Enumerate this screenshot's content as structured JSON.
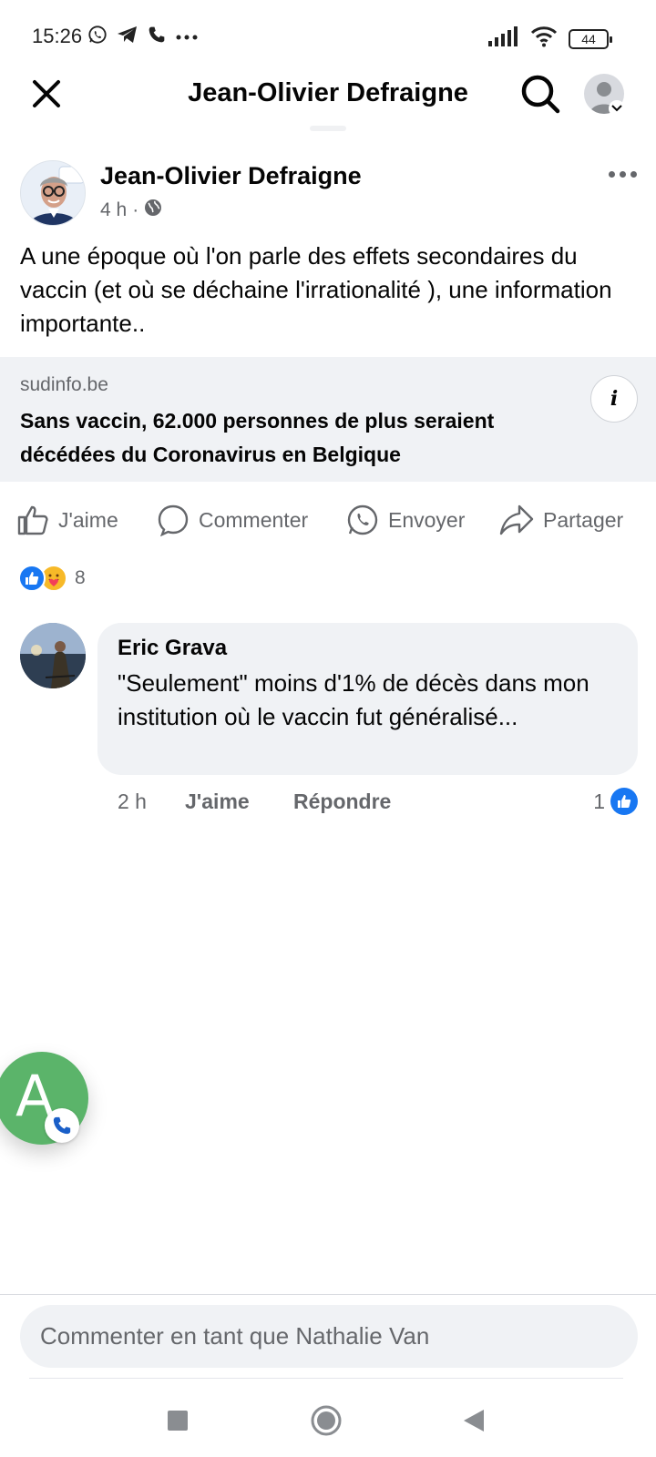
{
  "status_bar": {
    "time": "15:26",
    "battery": "44",
    "icons": [
      "whatsapp-icon",
      "telegram-icon",
      "phone-icon",
      "more-dots-icon",
      "signal-icon",
      "wifi-icon",
      "battery-icon"
    ]
  },
  "top_bar": {
    "title": "Jean-Olivier Defraigne",
    "icons": [
      "close-icon",
      "search-icon",
      "profile-icon"
    ]
  },
  "post": {
    "author": "Jean-Olivier Defraigne",
    "time": "4 h",
    "separator": "·",
    "text": "A une époque où l'on parle des effets secondaires du vaccin (et où se déchaine l'irrationalité ), une information importante..",
    "link": {
      "domain": "sudinfo.be",
      "title": "Sans vaccin, 62.000 personnes de plus seraient décédées du Coronavirus en Belgique",
      "info_label": "i"
    },
    "actions": {
      "like": "J'aime",
      "comment": "Commenter",
      "send": "Envoyer",
      "share": "Partager"
    },
    "reactions": {
      "types": [
        "like",
        "care"
      ],
      "count": "8"
    }
  },
  "comment": {
    "author": "Eric Grava",
    "text": "\"Seulement\" moins d'1% de décès dans mon institution où le vaccin fut généralisé...",
    "time": "2 h",
    "like": "J'aime",
    "reply": "Répondre",
    "like_count": "1"
  },
  "chat_head": {
    "letter": "A"
  },
  "comment_input": {
    "placeholder": "Commenter en tant que Nathalie Van"
  },
  "colors": {
    "accent": "#1877f2",
    "secondary_text": "#65676b",
    "surface": "#f0f2f5",
    "chat_head": "#5bb46a"
  }
}
